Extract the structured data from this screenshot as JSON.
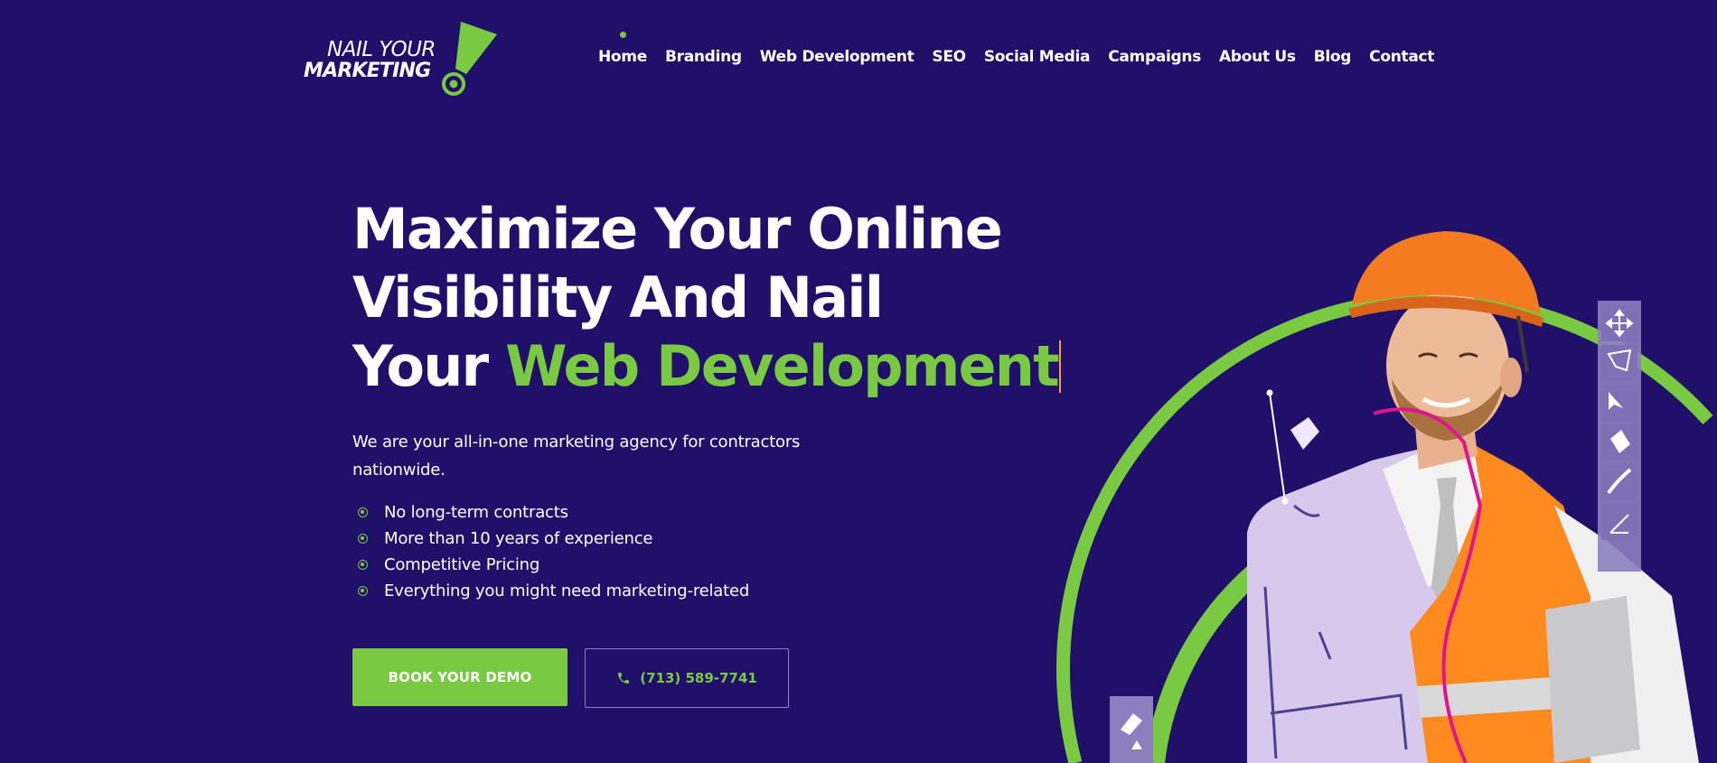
{
  "header": {
    "logo": {
      "line1": "NAIL YOUR",
      "line2": "MARKETING"
    },
    "nav": [
      {
        "label": "Home",
        "active": true
      },
      {
        "label": "Branding"
      },
      {
        "label": "Web Development"
      },
      {
        "label": "SEO"
      },
      {
        "label": "Social Media"
      },
      {
        "label": "Campaigns"
      },
      {
        "label": "About Us"
      },
      {
        "label": "Blog"
      },
      {
        "label": "Contact"
      }
    ]
  },
  "hero": {
    "title_line1": "Maximize Your Online",
    "title_line2": "Visibility And Nail",
    "title_line3_prefix": "Your ",
    "title_line3_accent": "Web Development",
    "subtitle": "We are your all-in-one marketing agency for contractors nationwide.",
    "bullets": [
      "No long-term contracts",
      "More than 10 years of experience",
      "Competitive Pricing",
      "Everything you might need marketing-related"
    ],
    "cta_primary": "BOOK YOUR DEMO",
    "cta_phone": "(713) 589-7741"
  },
  "icons": {
    "nav_active_indicator": "dot-icon",
    "bullet": "circle-dot-icon",
    "phone": "phone-icon",
    "toolbar": [
      "move-icon",
      "lasso-icon",
      "select-move-icon",
      "paint-bucket-icon",
      "brush-icon",
      "pen-tool-icon"
    ]
  },
  "colors": {
    "background": "#20106a",
    "accent": "#79c943",
    "text": "#ffffff",
    "caret": "#f0a040",
    "hardhat": "#f47b20",
    "vest": "#ff8a1f",
    "path_stroke": "#e0148c",
    "toolbar": "#8b7fc0"
  }
}
